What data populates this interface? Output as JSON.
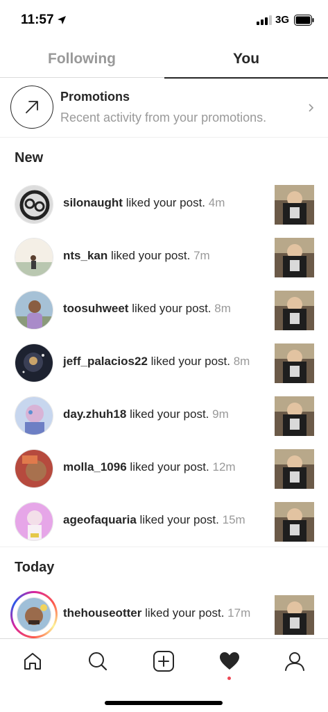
{
  "status_bar": {
    "time": "11:57",
    "network": "3G",
    "icons": [
      "location-arrow-icon",
      "signal-icon",
      "battery-icon"
    ]
  },
  "tabs": [
    {
      "label": "Following",
      "active": false
    },
    {
      "label": "You",
      "active": true
    }
  ],
  "promotions": {
    "title": "Promotions",
    "subtitle": "Recent activity from your promotions.",
    "icon": "arrow-up-right-icon"
  },
  "sections": {
    "new": "New",
    "today": "Today"
  },
  "activity_new": [
    {
      "user": "silonaught",
      "action": "liked your post.",
      "time": "4m"
    },
    {
      "user": "nts_kan",
      "action": "liked your post.",
      "time": "7m"
    },
    {
      "user": "toosuhweet",
      "action": "liked your post.",
      "time": "8m"
    },
    {
      "user": "jeff_palacios22",
      "action": "liked your post.",
      "time": "8m"
    },
    {
      "user": "day.zhuh18",
      "action": "liked your post.",
      "time": "9m"
    },
    {
      "user": "molla_1096",
      "action": "liked your post.",
      "time": "12m"
    },
    {
      "user": "ageofaquaria",
      "action": "liked your post.",
      "time": "15m"
    }
  ],
  "activity_today": [
    {
      "user": "thehouseotter",
      "action": "liked your post.",
      "time": "17m",
      "has_story": true
    }
  ],
  "bottom_nav": [
    "home-icon",
    "search-icon",
    "add-post-icon",
    "heart-icon",
    "profile-icon"
  ],
  "colors": {
    "text": "#262626",
    "muted": "#999999",
    "notification_dot": "#ed4956"
  }
}
